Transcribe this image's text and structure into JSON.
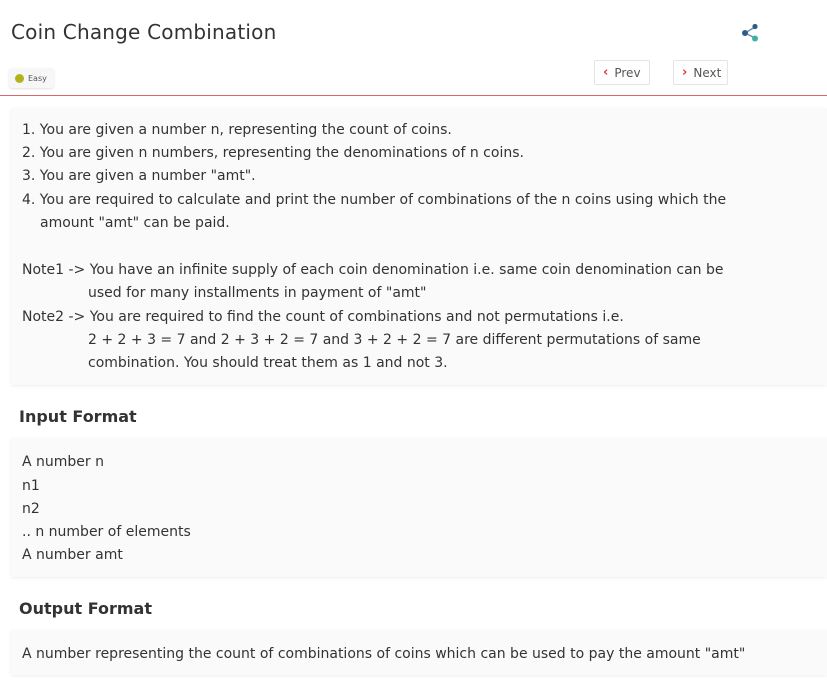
{
  "header": {
    "title": "Coin Change Combination",
    "difficulty": "Easy",
    "difficulty_color": "#b3b319",
    "share_icon": "share-icon",
    "prev_label": "Prev",
    "next_label": "Next",
    "accent_color": "#e23a3a"
  },
  "problem": {
    "lines": [
      "1. You are given a number n, representing the count of coins.",
      "2. You are given n numbers, representing the denominations of n coins.",
      "3. You are given a number \"amt\".",
      "4. You are required to calculate and print the number of combinations of the n coins using which the",
      "amount \"amt\" can be paid.",
      "Note1 -> You have an infinite supply of each coin denomination i.e. same coin denomination can be",
      "used for many installments in payment of \"amt\"",
      "Note2 -> You are required to find the count of combinations and not permutations i.e.",
      "2 + 2 + 3 = 7 and 2 + 3 + 2 = 7 and 3 + 2 + 2 = 7 are different permutations of same",
      "combination. You should treat them as 1 and not 3."
    ]
  },
  "input_format": {
    "heading": "Input Format",
    "lines": [
      "A number n",
      "n1",
      "n2",
      ".. n number of elements",
      "A number amt"
    ]
  },
  "output_format": {
    "heading": "Output Format",
    "text": "A number representing the count of combinations of coins which can be used to pay the amount \"amt\""
  }
}
